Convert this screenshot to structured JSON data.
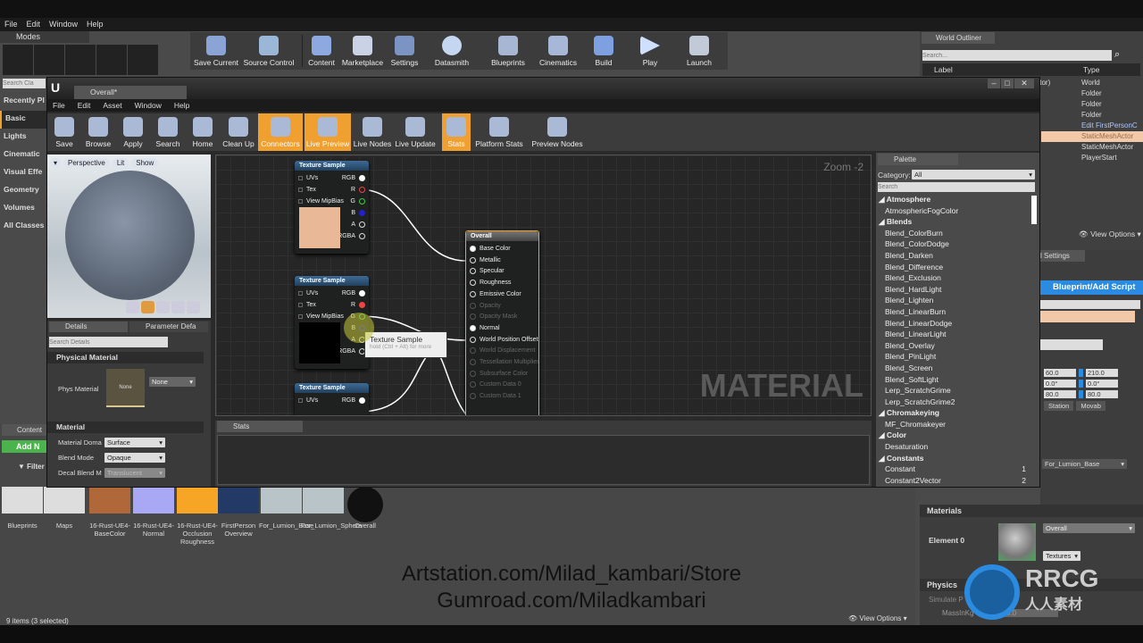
{
  "main_menu": [
    "File",
    "Edit",
    "Window",
    "Help"
  ],
  "modes_tab": "Modes",
  "modes_search_placeholder": "Search Cla",
  "modes_list": [
    "Recently Pl",
    "Basic",
    "Lights",
    "Cinematic",
    "Visual Effe",
    "Geometry",
    "Volumes",
    "All Classes"
  ],
  "main_toolbar": [
    "Save Current",
    "Source Control",
    "Content",
    "Marketplace",
    "Settings",
    "Datasmith",
    "Blueprints",
    "Cinematics",
    "Build",
    "Play",
    "Launch"
  ],
  "outliner": {
    "tab": "World Outliner",
    "search_placeholder": "Search...",
    "col_label": "Label",
    "col_type": "Type",
    "label_fragment": "ditor)",
    "types": [
      "World",
      "Folder",
      "Folder",
      "Folder",
      "Edit FirstPersonC",
      "StaticMeshActor",
      "StaticMeshActor",
      "PlayerStart"
    ],
    "view_options": "View Options"
  },
  "mat_editor": {
    "tab": "Overall*",
    "menu": [
      "File",
      "Edit",
      "Asset",
      "Window",
      "Help"
    ],
    "toolbar": [
      {
        "label": "Save",
        "on": false
      },
      {
        "label": "Browse",
        "on": false
      },
      {
        "label": "Apply",
        "on": false
      },
      {
        "label": "Search",
        "on": false
      },
      {
        "label": "Home",
        "on": false
      },
      {
        "label": "Clean Up",
        "on": false
      },
      {
        "label": "Connectors",
        "on": true
      },
      {
        "label": "Live Preview",
        "on": true
      },
      {
        "label": "Live Nodes",
        "on": false
      },
      {
        "label": "Live Update",
        "on": false
      },
      {
        "label": "Stats",
        "on": true
      },
      {
        "label": "Platform Stats",
        "on": false
      },
      {
        "label": "Preview Nodes",
        "on": false
      }
    ],
    "viewport": {
      "perspective": "Perspective",
      "lit": "Lit",
      "show": "Show"
    },
    "details": {
      "tab": "Details",
      "tab2": "Parameter Defa",
      "search_placeholder": "Search Details",
      "sec_phys": "Physical Material",
      "phys_label": "Phys Material",
      "phys_thumb": "None",
      "phys_value": "None",
      "sec_mat": "Material",
      "rows": [
        {
          "label": "Material Doma",
          "value": "Surface"
        },
        {
          "label": "Blend Mode",
          "value": "Opaque"
        },
        {
          "label": "Decal Blend M",
          "value": "Translucent"
        }
      ]
    },
    "graph": {
      "zoom": "Zoom -2",
      "watermark": "MATERIAL",
      "tex_node_title": "Texture Sample",
      "tex_inputs": [
        "UVs",
        "Tex",
        "View MipBias"
      ],
      "tex_outputs": [
        "RGB",
        "R",
        "G",
        "B",
        "A",
        "RGBA"
      ],
      "result_node": {
        "title": "Overall",
        "pins": [
          {
            "n": "Base Color",
            "on": true
          },
          {
            "n": "Metallic",
            "on": true
          },
          {
            "n": "Specular",
            "on": true
          },
          {
            "n": "Roughness",
            "on": true
          },
          {
            "n": "Emissive Color",
            "on": true
          },
          {
            "n": "Opacity",
            "on": false
          },
          {
            "n": "Opacity Mask",
            "on": false
          },
          {
            "n": "Normal",
            "on": true
          },
          {
            "n": "World Position Offset",
            "on": true
          },
          {
            "n": "World Displacement",
            "on": false
          },
          {
            "n": "Tessellation Multiplier",
            "on": false
          },
          {
            "n": "Subsurface Color",
            "on": false
          },
          {
            "n": "Custom Data 0",
            "on": false
          },
          {
            "n": "Custom Data 1",
            "on": false
          }
        ]
      },
      "tooltip": {
        "title": "Texture Sample",
        "hint": "hold (Ctrl + Alt) for more"
      }
    },
    "stats_tab": "Stats",
    "palette": {
      "tab": "Palette",
      "category_label": "Category:",
      "category_value": "All",
      "search_placeholder": "Search",
      "items": [
        {
          "t": "Atmosphere",
          "cat": true
        },
        {
          "t": "AtmosphericFogColor"
        },
        {
          "t": "Blends",
          "cat": true
        },
        {
          "t": "Blend_ColorBurn"
        },
        {
          "t": "Blend_ColorDodge"
        },
        {
          "t": "Blend_Darken"
        },
        {
          "t": "Blend_Difference"
        },
        {
          "t": "Blend_Exclusion"
        },
        {
          "t": "Blend_HardLight"
        },
        {
          "t": "Blend_Lighten"
        },
        {
          "t": "Blend_LinearBurn"
        },
        {
          "t": "Blend_LinearDodge"
        },
        {
          "t": "Blend_LinearLight"
        },
        {
          "t": "Blend_Overlay"
        },
        {
          "t": "Blend_PinLight"
        },
        {
          "t": "Blend_Screen"
        },
        {
          "t": "Blend_SoftLight"
        },
        {
          "t": "Lerp_ScratchGrime"
        },
        {
          "t": "Lerp_ScratchGrime2"
        },
        {
          "t": "Chromakeying",
          "cat": true
        },
        {
          "t": "MF_Chromakeyer"
        },
        {
          "t": "Color",
          "cat": true
        },
        {
          "t": "Desaturation"
        },
        {
          "t": "Constants",
          "cat": true
        },
        {
          "t": "Constant",
          "key": "1"
        },
        {
          "t": "Constant2Vector",
          "key": "2"
        }
      ]
    }
  },
  "right_details": {
    "tab": "l Settings",
    "blueprint_btn": "Blueprint/Add Script",
    "transform": [
      [
        "60.0",
        "210.0"
      ],
      [
        "0.0°",
        "0.0°"
      ],
      [
        "80.0",
        "80.0"
      ]
    ],
    "station": "Station",
    "movab": "Movab",
    "mesh_value": "For_Lumion_Base",
    "materials_sec": "Materials",
    "element": "Element 0",
    "material_value": "Overall",
    "textures_btn": "Textures",
    "physics_sec": "Physics",
    "simulate": "Simulate P",
    "mass": "MassInKg",
    "mass_val": "0.0"
  },
  "content": {
    "tab": "Content",
    "add_new": "Add N",
    "filter": "Filter",
    "assets": [
      {
        "n": "Blueprints",
        "c": "#ddd"
      },
      {
        "n": "Maps",
        "c": "#ddd"
      },
      {
        "n": "16-Rust-UE4-BaseColor",
        "c": "#b0673a"
      },
      {
        "n": "16-Rust-UE4-Normal",
        "c": "#a9a8f5"
      },
      {
        "n": "16-Rust-UE4-Occlusion Roughness",
        "c": "#f6a524"
      },
      {
        "n": "FirstPerson Overview",
        "c": "#243a66"
      },
      {
        "n": "For_Lumion_Base",
        "c": "#b8c4c8"
      },
      {
        "n": "For_Lumion_Sphere",
        "c": "#b8c4c8"
      },
      {
        "n": "Overall",
        "c": "#111"
      }
    ],
    "status": "9 items (3 selected)",
    "view_options": "View Options"
  },
  "overlay": {
    "line1": "Artstation.com/Milad_kambari/Store",
    "line2": "Gumroad.com/Miladkambari",
    "logo": "RRCG 人人素材"
  },
  "colors": {
    "accent": "#f0a030",
    "blue": "#2b8be0",
    "selection": "#f2c9a8"
  }
}
